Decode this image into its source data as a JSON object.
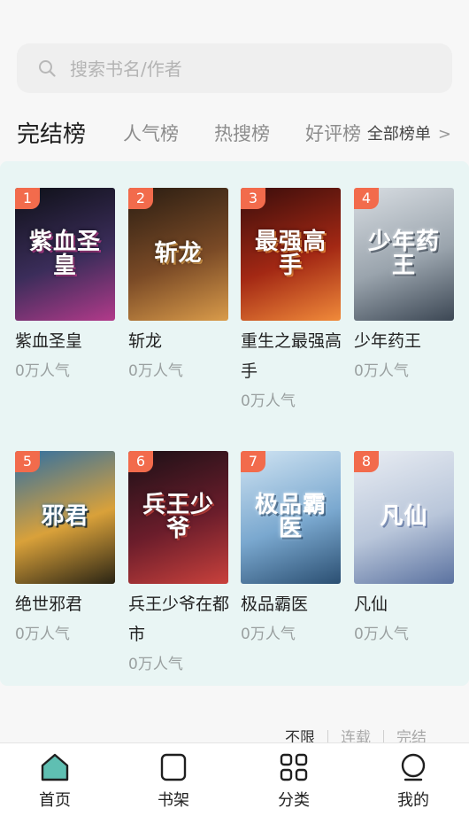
{
  "search": {
    "placeholder": "搜索书名/作者"
  },
  "tabs": [
    {
      "label": "完结榜",
      "active": true
    },
    {
      "label": "人气榜",
      "active": false
    },
    {
      "label": "热搜榜",
      "active": false
    },
    {
      "label": "好评榜",
      "active": false
    }
  ],
  "all_lists_label": "全部榜单",
  "books": [
    {
      "rank": "1",
      "name": "紫血圣皇",
      "popularity": "0万人气",
      "cover_title": "紫血圣皇",
      "cover_colors": [
        "#0e1017",
        "#3b2d5a",
        "#b23a8a"
      ]
    },
    {
      "rank": "2",
      "name": "斩龙",
      "popularity": "0万人气",
      "cover_title": "斩龙",
      "cover_colors": [
        "#2a1d12",
        "#7a4a26",
        "#d99b4a"
      ]
    },
    {
      "rank": "3",
      "name": "重生之最强高手",
      "popularity": "0万人气",
      "cover_title": "最强高手",
      "cover_colors": [
        "#3a0d0b",
        "#a32814",
        "#f08a3a"
      ]
    },
    {
      "rank": "4",
      "name": "少年药王",
      "popularity": "0万人气",
      "cover_title": "少年药王",
      "cover_colors": [
        "#d8dde2",
        "#9aa4ad",
        "#3c4754"
      ]
    },
    {
      "rank": "5",
      "name": "绝世邪君",
      "popularity": "0万人气",
      "cover_title": "邪君",
      "cover_colors": [
        "#2f6fa3",
        "#d9a13a",
        "#2a2414"
      ]
    },
    {
      "rank": "6",
      "name": "兵王少爷在都市",
      "popularity": "0万人气",
      "cover_title": "兵王少爷",
      "cover_colors": [
        "#1b1016",
        "#6b1d2b",
        "#c9413c"
      ]
    },
    {
      "rank": "7",
      "name": "极品霸医",
      "popularity": "0万人气",
      "cover_title": "极品霸医",
      "cover_colors": [
        "#cfe3f2",
        "#7aa8cf",
        "#2b4f72"
      ]
    },
    {
      "rank": "8",
      "name": "凡仙",
      "popularity": "0万人气",
      "cover_title": "凡仙",
      "cover_colors": [
        "#e9edf3",
        "#b9c6da",
        "#5b72a0"
      ]
    }
  ],
  "filters": [
    {
      "label": "不限",
      "active": true
    },
    {
      "label": "连载",
      "active": false
    },
    {
      "label": "完结",
      "active": false
    }
  ],
  "nav": [
    {
      "label": "首页",
      "icon": "home-icon"
    },
    {
      "label": "书架",
      "icon": "bookshelf-icon"
    },
    {
      "label": "分类",
      "icon": "category-icon"
    },
    {
      "label": "我的",
      "icon": "profile-icon"
    }
  ],
  "colors": {
    "accent": "#5fbfb2",
    "rank_badge": "#f26b4c",
    "panel_bg": "#e9f5f4"
  }
}
